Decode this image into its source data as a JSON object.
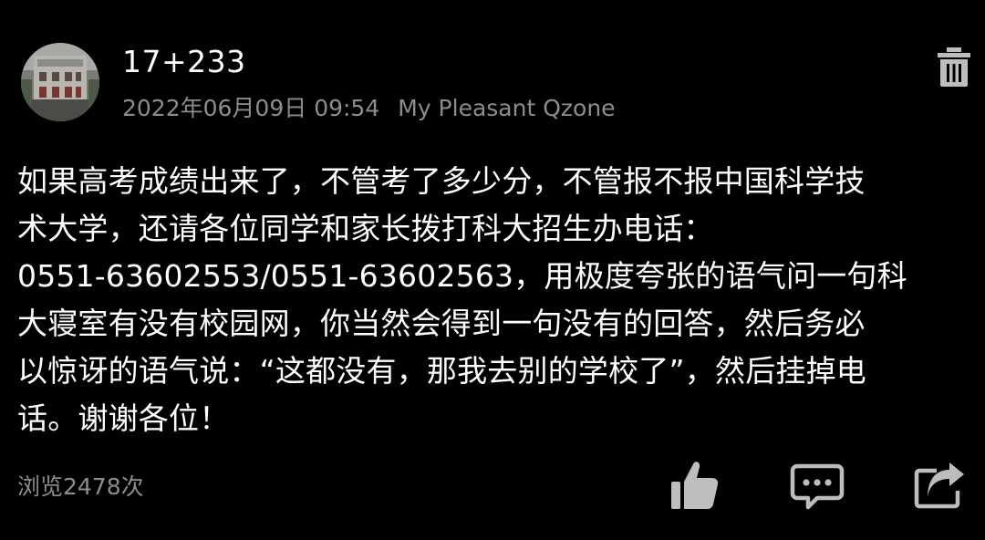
{
  "post": {
    "author": "17+233",
    "timestamp": "2022年06月09日 09:54",
    "source": "My Pleasant Qzone",
    "avatar_icon": "building-photo-avatar",
    "content_lines": [
      "如果高考成绩出来了，不管考了多少分，不管报不报中国科学技",
      "术大学，还请各位同学和家长拨打科大招生办电话：",
      "0551-63602553/0551-63602563，用极度夸张的语气问一句科",
      "大寝室有没有校园网，你当然会得到一句没有的回答，然后务必",
      "以惊讶的语气说：“这都没有，那我去别的学校了”，然后挂掉电",
      "话。谢谢各位！"
    ],
    "views": "浏览2478次"
  },
  "actions": {
    "delete_icon": "trash-icon",
    "like_icon": "thumbs-up-icon",
    "comment_icon": "comment-icon",
    "share_icon": "share-icon"
  },
  "colors": {
    "background": "#000000",
    "primary_text": "#ffffff",
    "secondary_text": "#8d8d8d",
    "icon": "#bdbdbd"
  }
}
